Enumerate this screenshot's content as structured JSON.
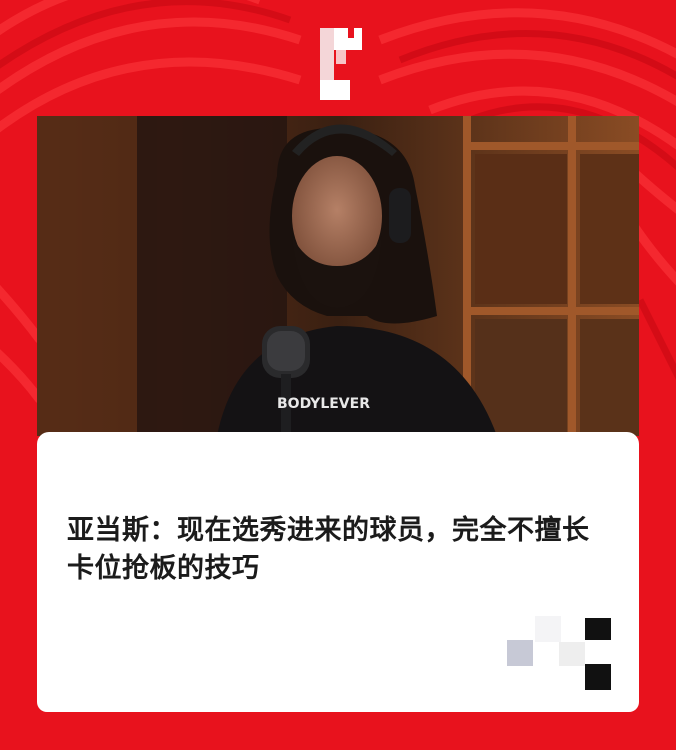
{
  "headline": "亚当斯：现在选秀进来的球员，完全不擅长卡位抢板的技巧",
  "shirt_text": "BODYLEVER",
  "colors": {
    "background": "#e8121d",
    "card": "#ffffff",
    "headline_text": "#1b1b1b"
  },
  "icons": {
    "logo": "brand-logo-pixelated",
    "watermark": "pixelated-watermark"
  }
}
